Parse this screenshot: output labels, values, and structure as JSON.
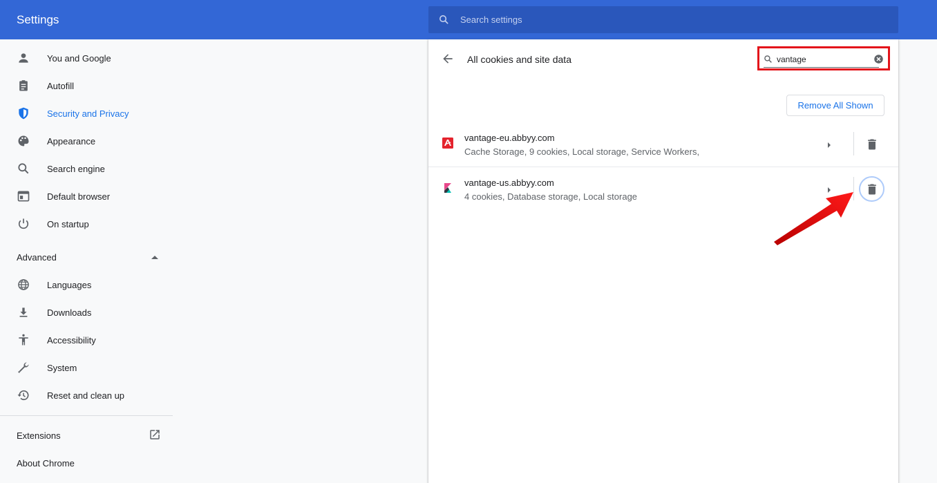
{
  "header": {
    "title": "Settings",
    "search_placeholder": "Search settings"
  },
  "sidebar": {
    "items": [
      {
        "label": "You and Google",
        "icon": "person-icon"
      },
      {
        "label": "Autofill",
        "icon": "clipboard-icon"
      },
      {
        "label": "Security and Privacy",
        "icon": "shield-icon",
        "active": true
      },
      {
        "label": "Appearance",
        "icon": "palette-icon"
      },
      {
        "label": "Search engine",
        "icon": "search-icon"
      },
      {
        "label": "Default browser",
        "icon": "browser-icon"
      },
      {
        "label": "On startup",
        "icon": "power-icon"
      }
    ],
    "advanced_label": "Advanced",
    "advanced_items": [
      {
        "label": "Languages",
        "icon": "globe-icon"
      },
      {
        "label": "Downloads",
        "icon": "download-icon"
      },
      {
        "label": "Accessibility",
        "icon": "accessibility-icon"
      },
      {
        "label": "System",
        "icon": "wrench-icon"
      },
      {
        "label": "Reset and clean up",
        "icon": "history-icon"
      }
    ],
    "extensions_label": "Extensions",
    "about_label": "About Chrome"
  },
  "content": {
    "title": "All cookies and site data",
    "filter_value": "vantage",
    "remove_all_label": "Remove All Shown",
    "sites": [
      {
        "name": "vantage-eu.abbyy.com",
        "details": "Cache Storage, 9 cookies, Local storage, Service Workers,"
      },
      {
        "name": "vantage-us.abbyy.com",
        "details": "4 cookies, Database storage, Local storage"
      }
    ]
  },
  "colors": {
    "header_bg": "#3367d6",
    "accent": "#1a73e8",
    "highlight_box": "#e3141b",
    "annotation_arrow": "#ff0000"
  }
}
